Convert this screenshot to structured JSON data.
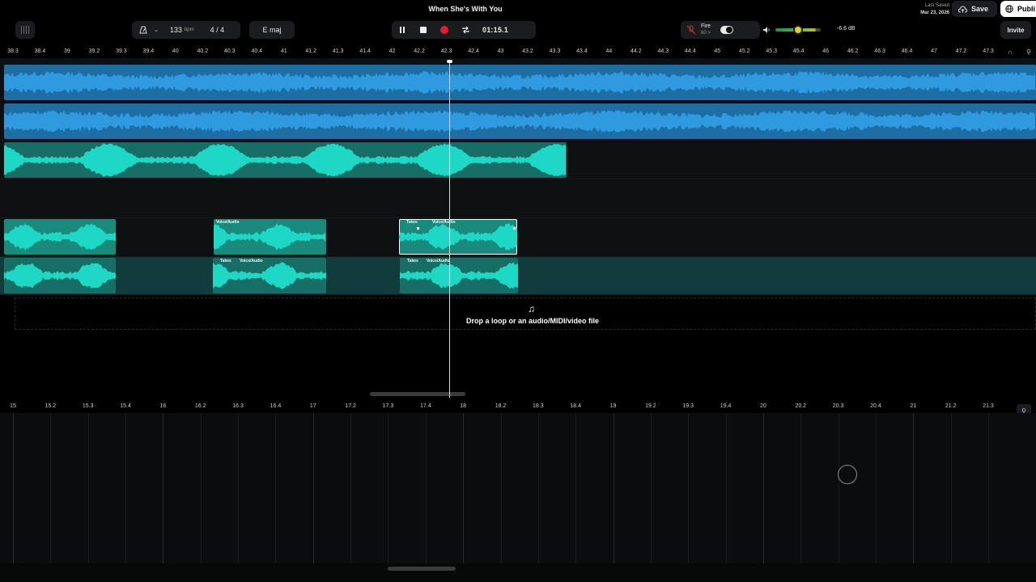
{
  "header": {
    "song_title": "When She's With You",
    "bpm_value": "133",
    "bpm_unit": "bpm",
    "time_signature": "4 / 4",
    "key": "E maj",
    "time_display": "01:15.1",
    "instrument_name": "Fire",
    "instrument_sub": "60 >",
    "volume_db": "-6.6 dB",
    "volume_level": 0.55,
    "last_saved_label": "Last Saved",
    "last_saved_date": "Mar 23, 2026",
    "save_label": "Save",
    "publish_label": "Publi",
    "invite_label": "Invite"
  },
  "ruler_top": [
    "38.3",
    "38.4",
    "39",
    "39.2",
    "39.3",
    "39.4",
    "40",
    "40.2",
    "40.3",
    "40.4",
    "41",
    "41.2",
    "41.3",
    "41.4",
    "42",
    "42.2",
    "42.3",
    "42.4",
    "43",
    "43.2",
    "43.3",
    "43.4",
    "44",
    "44.2",
    "44.3",
    "44.4",
    "45",
    "45.2",
    "45.3",
    "45.4",
    "46",
    "46.2",
    "46.3",
    "46.4",
    "47",
    "47.2",
    "47.3"
  ],
  "ruler_bottom": [
    "15",
    "15.2",
    "15.3",
    "15.4",
    "16",
    "16.2",
    "16.3",
    "16.4",
    "17",
    "17.2",
    "17.3",
    "17.4",
    "18",
    "18.2",
    "18.3",
    "18.4",
    "19",
    "19.2",
    "19.3",
    "19.4",
    "20",
    "20.2",
    "20.3",
    "20.4",
    "21",
    "21.2",
    "21.3"
  ],
  "clips": {
    "takes_label": "Takes",
    "voice_audio_label": "Voice/Audio"
  },
  "dropzone": {
    "text": "Drop a loop or an audio/MIDI/video file",
    "icon": "music-note-plus-icon"
  },
  "colors": {
    "audio_blue": "#2f9ae0",
    "voice_teal": "#1ed7c4",
    "record_red": "#e11d2e",
    "selected_lane": "#123c3b"
  }
}
